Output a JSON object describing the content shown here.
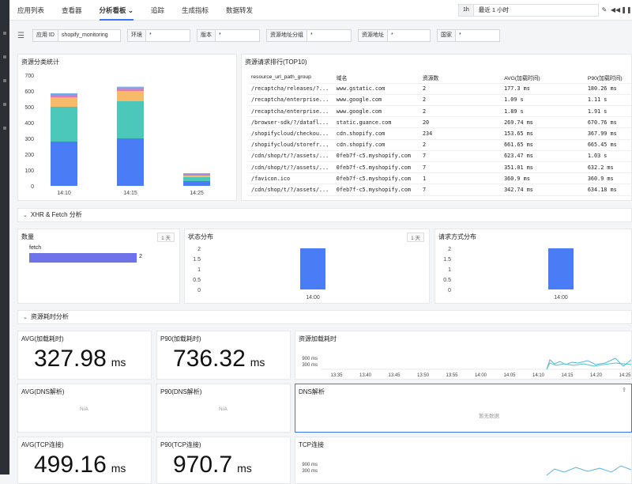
{
  "nav": {
    "tabs": [
      "应用列表",
      "查看器",
      "分析看板 ⌄",
      "追踪",
      "生成指标",
      "数据转发"
    ]
  },
  "time": {
    "quick": "1h",
    "range": "最近 1 小时"
  },
  "filters": [
    {
      "label": "应用 ID",
      "value": "shopify_monitoring"
    },
    {
      "label": "环境",
      "value": "*"
    },
    {
      "label": "版本",
      "value": "*"
    },
    {
      "label": "资源地址分组",
      "value": "*"
    },
    {
      "label": "资源地址",
      "value": "*"
    },
    {
      "label": "国家",
      "value": "*"
    }
  ],
  "resource_category": {
    "title": "资源分类统计",
    "chart_data": {
      "type": "bar",
      "stacked": true,
      "categories": [
        "14:10",
        "14:15",
        "14:25"
      ],
      "ylim": [
        0,
        700
      ],
      "yticks": [
        0,
        100,
        200,
        300,
        400,
        500,
        600,
        700
      ],
      "series": [
        {
          "color": "#4a7cf5",
          "values": [
            280,
            300,
            30
          ]
        },
        {
          "color": "#4bc8b9",
          "values": [
            220,
            235,
            25
          ]
        },
        {
          "color": "#f7b96a",
          "values": [
            60,
            65,
            10
          ]
        },
        {
          "color": "#e8799c",
          "values": [
            10,
            12,
            5
          ]
        },
        {
          "color": "#9f8de6",
          "values": [
            10,
            10,
            5
          ]
        },
        {
          "color": "#6fb7e9",
          "values": [
            5,
            5,
            5
          ]
        }
      ]
    }
  },
  "top10": {
    "title": "资源请求排行(TOP10)",
    "headers": [
      "resource_url_path_group",
      "域名",
      "资源数",
      "AVG(加载时间)",
      "P90(加载时间)"
    ],
    "rows": [
      [
        "/recaptcha/releases/?...",
        "www.gstatic.com",
        "2",
        "177.3 ms",
        "180.26 ms"
      ],
      [
        "/recaptcha/enterprise...",
        "www.google.com",
        "2",
        "1.09 s",
        "1.11 s"
      ],
      [
        "/recaptcha/enterprise...",
        "www.google.com",
        "2",
        "1.89 s",
        "1.91 s"
      ],
      [
        "/browser-sdk/?/datafl...",
        "static.guance.com",
        "20",
        "269.74 ms",
        "670.76 ms"
      ],
      [
        "/shopifycloud/checkou...",
        "cdn.shopify.com",
        "234",
        "153.65 ms",
        "367.99 ms"
      ],
      [
        "/shopifycloud/storefr...",
        "cdn.shopify.com",
        "2",
        "661.65 ms",
        "665.45 ms"
      ],
      [
        "/cdn/shop/t/?/assets/...",
        "0feb7f-c5.myshopify.com",
        "7",
        "623.47 ms",
        "1.03 s"
      ],
      [
        "/cdn/shop/t/?/assets/...",
        "0feb7f-c5.myshopify.com",
        "7",
        "351.01 ms",
        "632.2 ms"
      ],
      [
        "/favicon.ico",
        "0feb7f-c5.myshopify.com",
        "1",
        "360.9 ms",
        "360.9 ms"
      ],
      [
        "/cdn/shop/t/?/assets/...",
        "0feb7f-c5.myshopify.com",
        "7",
        "342.74 ms",
        "634.18 ms"
      ]
    ]
  },
  "xhr_section": {
    "title": "XHR & Fetch 分析"
  },
  "count_panel": {
    "title": "数量",
    "badge": "1 天",
    "chart_data": {
      "type": "bar",
      "orientation": "horizontal",
      "categories": [
        "fetch"
      ],
      "values": [
        2
      ]
    }
  },
  "status_panel": {
    "title": "状态分布",
    "badge": "1 天",
    "chart_data": {
      "type": "bar",
      "categories": [
        "14:00"
      ],
      "values": [
        2
      ],
      "ylim": [
        0,
        2
      ],
      "yticks": [
        0,
        0.5,
        1,
        1.5,
        2
      ]
    }
  },
  "method_panel": {
    "title": "请求方式分布",
    "chart_data": {
      "type": "bar",
      "categories": [
        "14:00"
      ],
      "values": [
        2
      ],
      "ylim": [
        0,
        2
      ],
      "yticks": [
        0,
        0.5,
        1,
        1.5,
        2
      ]
    }
  },
  "timing_section": {
    "title": "资源耗时分析"
  },
  "stats": {
    "avg_load": {
      "title": "AVG(加载耗时)",
      "value": "327.98",
      "unit": "ms"
    },
    "p90_load": {
      "title": "P90(加载耗时)",
      "value": "736.32",
      "unit": "ms"
    },
    "avg_dns": {
      "title": "AVG(DNS解析)",
      "value": "N/A"
    },
    "p90_dns": {
      "title": "P90(DNS解析)",
      "value": "N/A"
    },
    "avg_tcp": {
      "title": "AVG(TCP连接)",
      "value": "499.16",
      "unit": "ms"
    },
    "p90_tcp": {
      "title": "P90(TCP连接)",
      "value": "970.7",
      "unit": "ms"
    }
  },
  "load_time_chart": {
    "title": "资源加载耗时",
    "chart_data": {
      "type": "line",
      "x": [
        "13:35",
        "13:40",
        "13:45",
        "13:50",
        "13:55",
        "14:00",
        "14:05",
        "14:10",
        "14:15",
        "14:20",
        "14:25"
      ],
      "yticks": [
        "300 ms",
        "900 ms"
      ]
    }
  },
  "dns_chart": {
    "title": "DNS解析",
    "empty": "暂无数据"
  },
  "tcp_chart": {
    "title": "TCP连接",
    "yticks": [
      "300 ms",
      "900 ms"
    ]
  }
}
